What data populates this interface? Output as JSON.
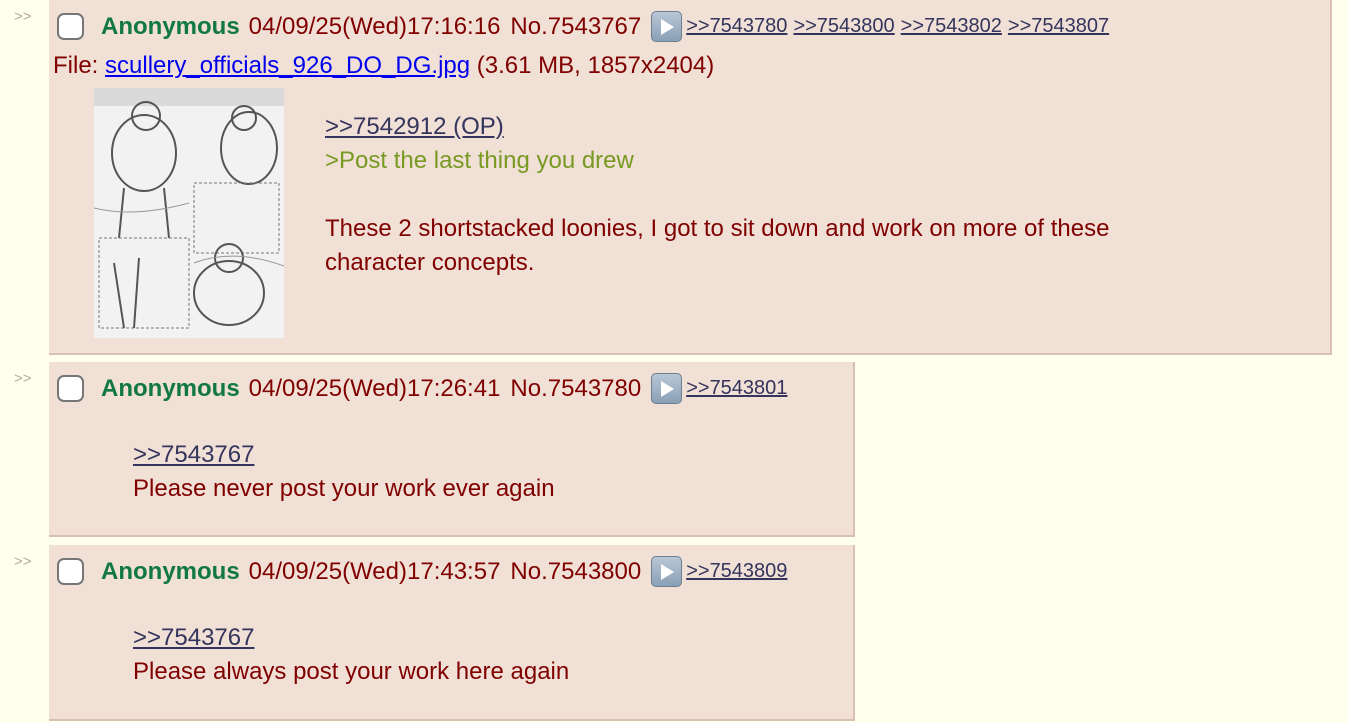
{
  "side_arrow": ">>",
  "posts": [
    {
      "name": "Anonymous",
      "datetime": "04/09/25(Wed)17:16:16",
      "number": "No.7543767",
      "backlinks": [
        ">>7543780",
        ">>7543800",
        ">>7543802",
        ">>7543807"
      ],
      "file": {
        "prefix": "File:",
        "filename": "scullery_officials_926_DO_DG.jpg",
        "info": "(3.61 MB, 1857x2404)"
      },
      "quote_link": ">>7542912 (OP)",
      "greentext": ">Post the last thing you drew",
      "text_line1": "These 2 shortstacked loonies, I got to sit down and work on more of these",
      "text_line2": "character concepts."
    },
    {
      "name": "Anonymous",
      "datetime": "04/09/25(Wed)17:26:41",
      "number": "No.7543780",
      "backlinks": [
        ">>7543801"
      ],
      "quote_link": ">>7543767",
      "text_line1": "Please never post your work ever again"
    },
    {
      "name": "Anonymous",
      "datetime": "04/09/25(Wed)17:43:57",
      "number": "No.7543800",
      "backlinks": [
        ">>7543809"
      ],
      "quote_link": ">>7543767",
      "text_line1": "Please always post your work here again"
    }
  ],
  "icons": {
    "checkbox": "checkbox-icon",
    "play": "play-icon",
    "thumbnail": "image-thumbnail"
  },
  "colors": {
    "background": "#ffffee",
    "post_background": "#f0e0d6",
    "name": "#117743",
    "text": "#800000",
    "greentext": "#789922",
    "link": "#34345c"
  }
}
